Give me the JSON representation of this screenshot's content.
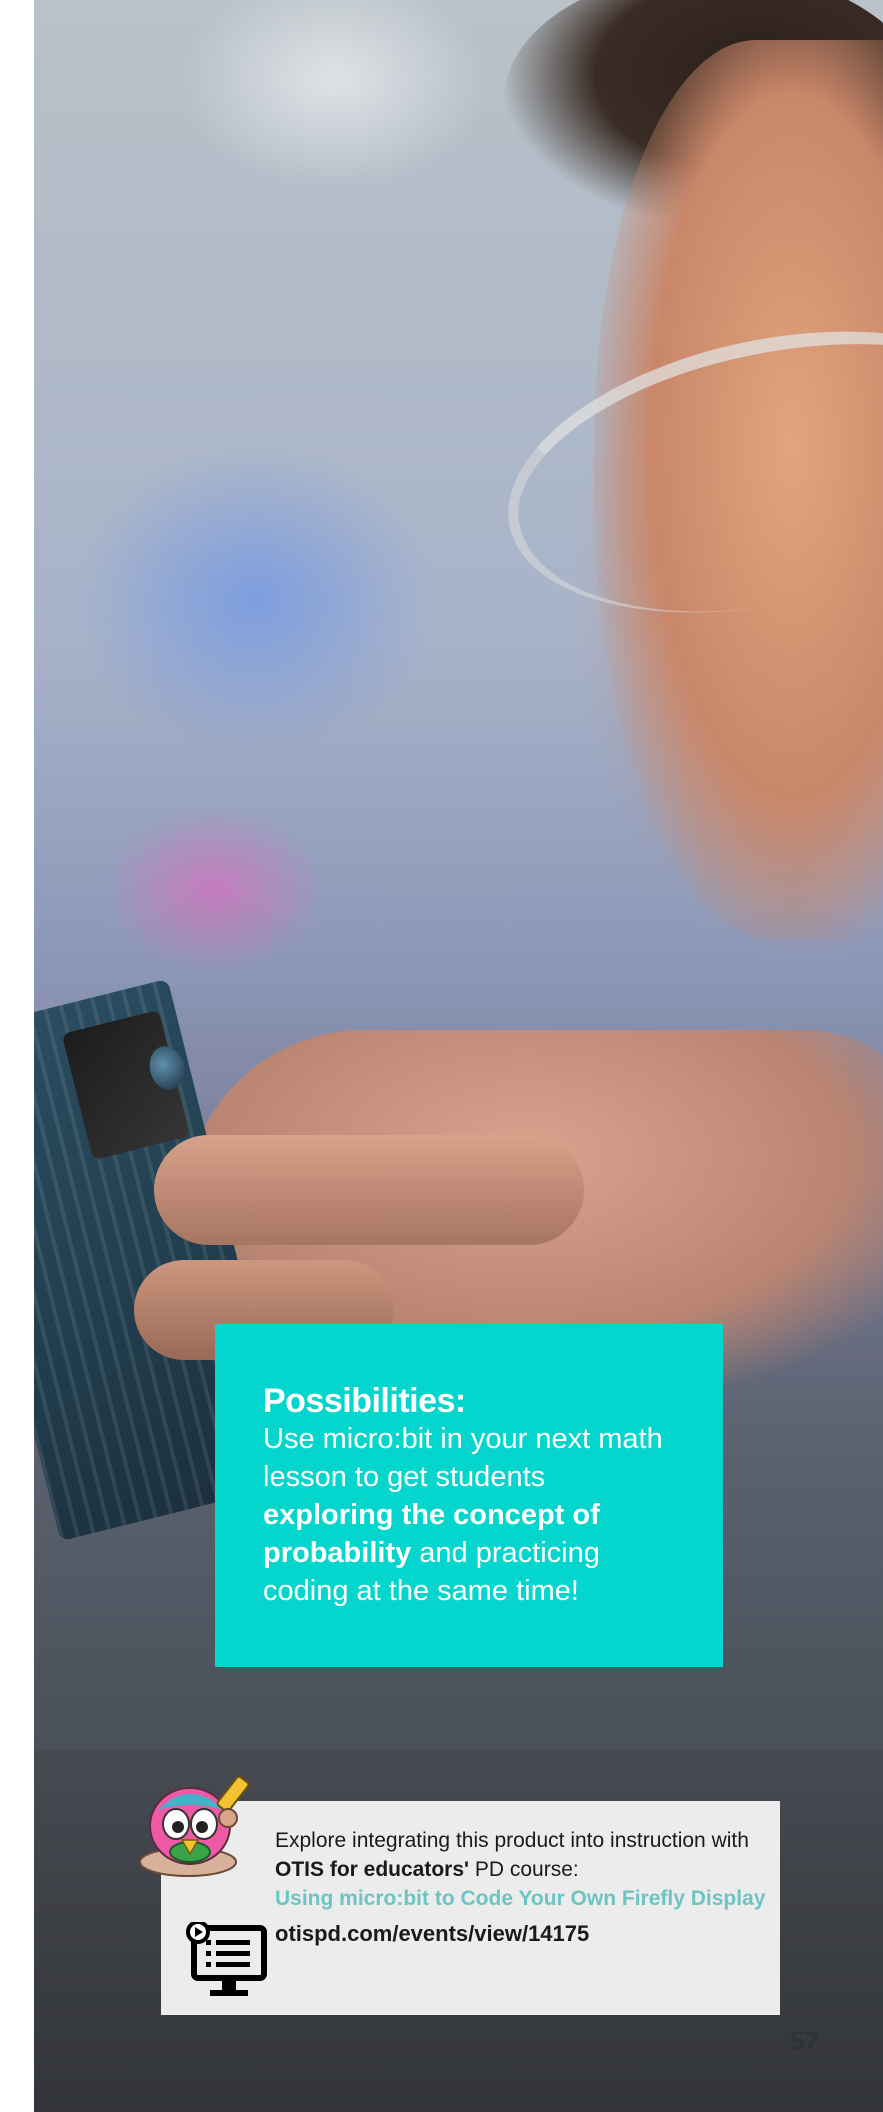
{
  "callout": {
    "title": "Possibilities:",
    "line1": "Use micro:bit in your next math lesson to get students ",
    "bold": "exploring the concept of probability",
    "line2": " and practicing coding at the same time!"
  },
  "pd": {
    "intro": "Explore integrating this product into instruction with ",
    "org": "OTIS for educators'",
    "intro_tail": " PD course:",
    "course_title": "Using micro:bit to Code Your Own Firefly Display",
    "url": "otispd.com/events/view/14175"
  },
  "page_number": "57",
  "icons": {
    "mascot": "otis-mascot-icon",
    "course": "online-course-icon"
  },
  "colors": {
    "accent": "#05d6cd",
    "link": "#6cc5c2",
    "box_bg": "#ececec"
  }
}
